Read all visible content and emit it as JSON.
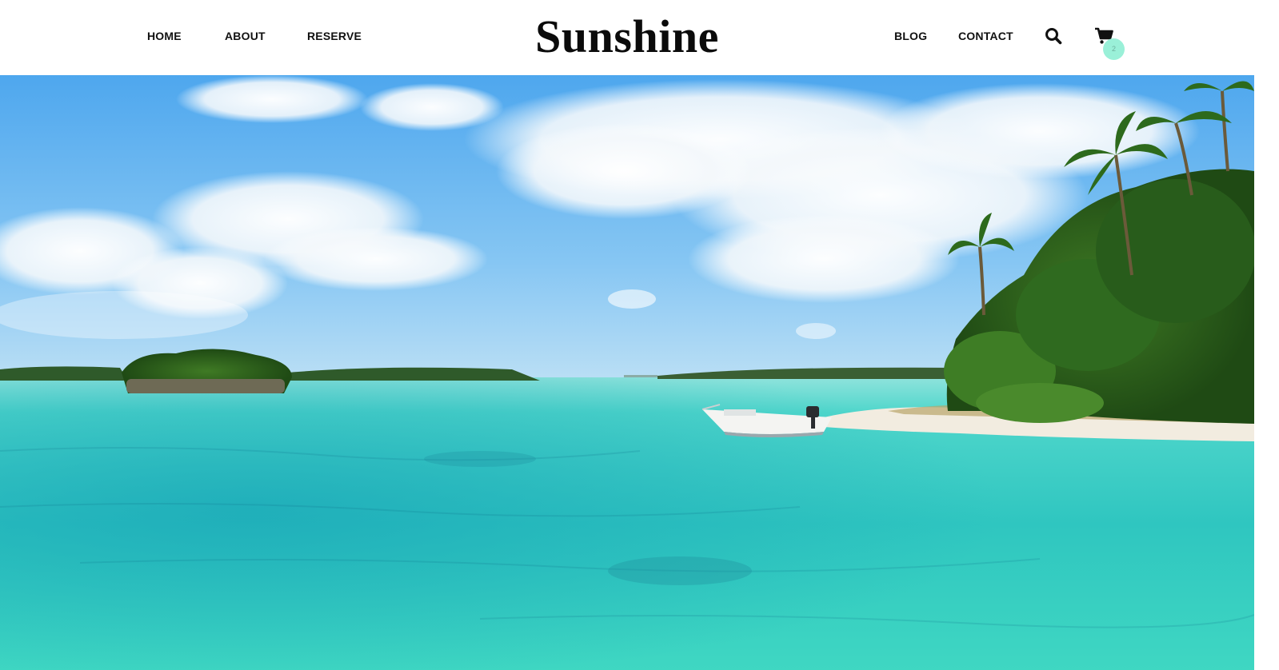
{
  "nav": {
    "left": [
      {
        "label": "HOME"
      },
      {
        "label": "ABOUT"
      },
      {
        "label": "RESERVE"
      }
    ],
    "right": [
      {
        "label": "BLOG"
      },
      {
        "label": "CONTACT"
      }
    ]
  },
  "logo": {
    "text": "Sunshine"
  },
  "cart": {
    "count": "2",
    "icon": "shopping-cart-icon"
  },
  "search": {
    "icon": "search-icon"
  },
  "hero": {
    "alt": "tropical beach with turquoise water, palm trees and a small white boat"
  },
  "colors": {
    "accent": "#9af0d8",
    "text": "#111111",
    "sky": "#7cc0f2",
    "water": "#3ed2c4"
  }
}
